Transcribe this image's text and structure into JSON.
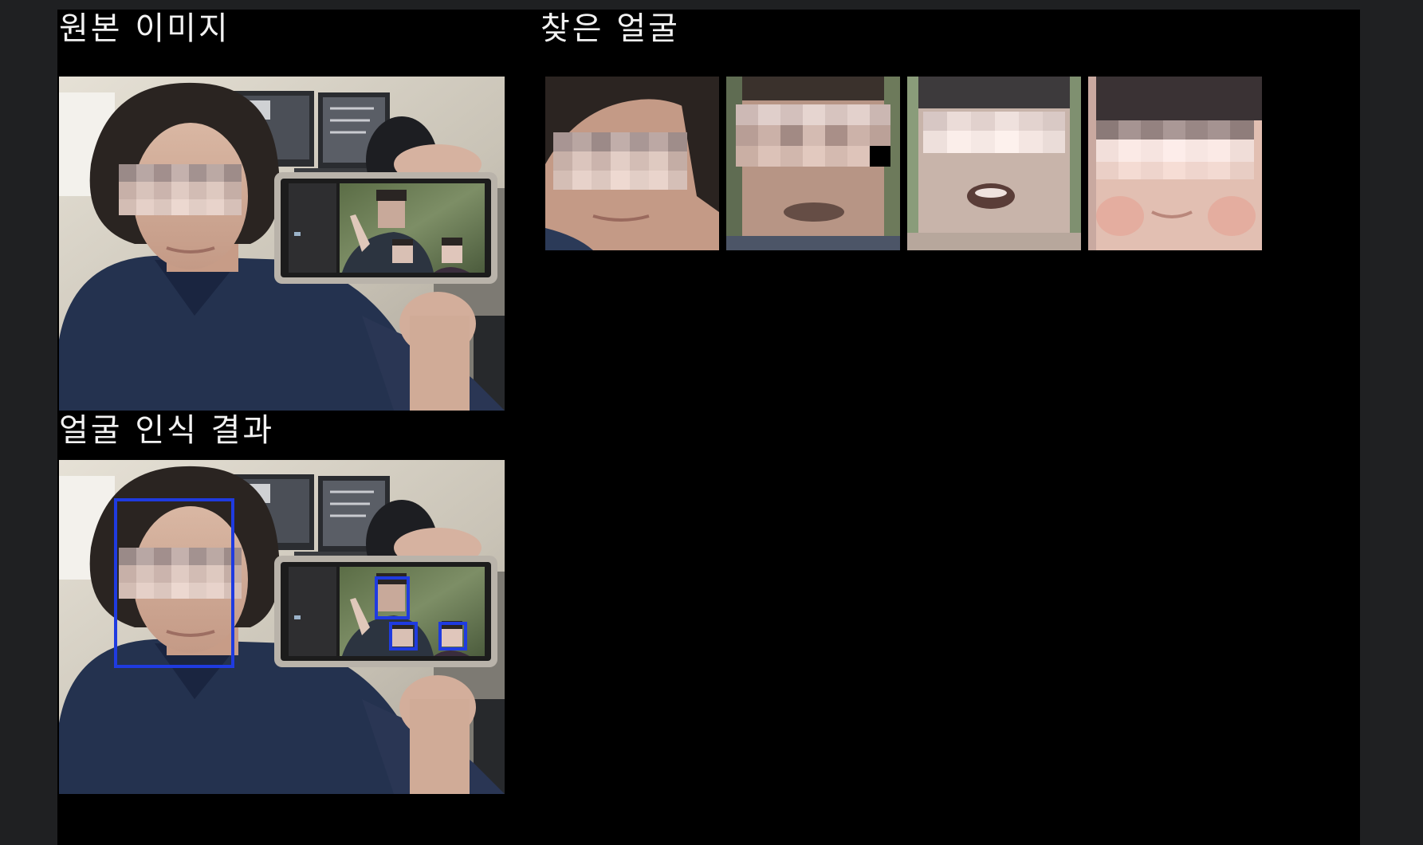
{
  "sections": {
    "original": {
      "title": "원본 이미지"
    },
    "detected": {
      "title": "얼굴 인식 결과"
    },
    "faces": {
      "title": "찾은 얼굴"
    }
  },
  "detection": {
    "box_color": "#1f3be0",
    "box_count": 4
  },
  "found_faces": [
    {
      "name": "face-crop-adult-man"
    },
    {
      "name": "face-crop-man-on-phone"
    },
    {
      "name": "face-crop-child-1"
    },
    {
      "name": "face-crop-child-2"
    }
  ]
}
